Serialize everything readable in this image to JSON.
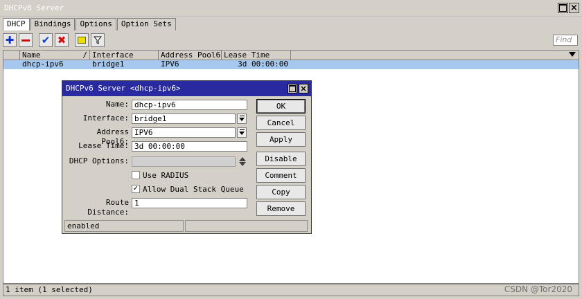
{
  "window": {
    "title": "DHCPv6 Server"
  },
  "tabs": [
    "DHCP",
    "Bindings",
    "Options",
    "Option Sets"
  ],
  "toolbar": {
    "add_icon": "plus-icon",
    "remove_icon": "minus-icon",
    "enable_icon": "check-icon",
    "disable_icon": "x-icon",
    "comment_icon": "note-icon",
    "filter_icon": "filter-icon",
    "find_placeholder": "Find"
  },
  "table": {
    "sort_mark": "/",
    "columns": [
      "Name",
      "Interface",
      "Address Pool6",
      "Lease Time"
    ],
    "rows": [
      {
        "name": "dhcp-ipv6",
        "interface": "bridge1",
        "pool": "IPV6",
        "lease": "3d 00:00:00",
        "selected": true
      }
    ]
  },
  "status": {
    "text": "1 item (1 selected)"
  },
  "watermark": "CSDN @Tor2020",
  "dialog": {
    "title": "DHCPv6 Server <dhcp-ipv6>",
    "fields": {
      "name_label": "Name:",
      "name_value": "dhcp-ipv6",
      "interface_label": "Interface:",
      "interface_value": "bridge1",
      "pool_label": "Address Pool6:",
      "pool_value": "IPV6",
      "lease_label": "Lease Time:",
      "lease_value": "3d 00:00:00",
      "options_label": "DHCP Options:",
      "options_value": "",
      "radius_label": "Use RADIUS",
      "radius_checked": false,
      "dual_label": "Allow Dual Stack Queue",
      "dual_checked": true,
      "route_label": "Route Distance:",
      "route_value": "1"
    },
    "buttons": [
      "OK",
      "Cancel",
      "Apply",
      "Disable",
      "Comment",
      "Copy",
      "Remove"
    ],
    "status": {
      "state": "enabled",
      "extra": ""
    }
  },
  "colors": {
    "selection": "#a6c8ee",
    "dialog_title": "#2a2aa0",
    "add": "#1030c8",
    "remove": "#d01010",
    "check": "#1040c0",
    "x": "#d01010",
    "note": "#f0e000"
  }
}
